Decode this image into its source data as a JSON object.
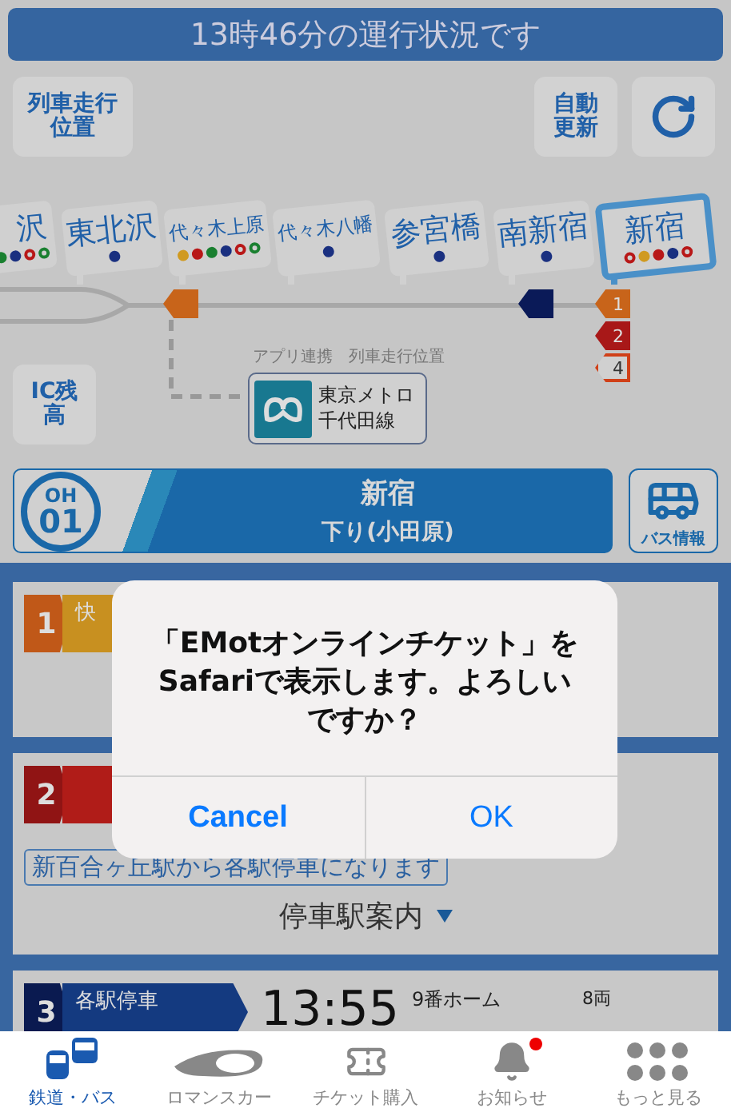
{
  "header": {
    "title": "13時46分の運行状況です"
  },
  "map": {
    "position_button": {
      "label": "列車走行位置"
    },
    "auto_update_button": {
      "label": "自動更新"
    },
    "ic_button": {
      "label": "IC残高"
    },
    "stations": [
      {
        "name": "沢",
        "selected": false,
        "dots": [
          {
            "color": "#1a8030",
            "hollow": false
          },
          {
            "color": "#1a3080",
            "hollow": false
          },
          {
            "color": "#b81818",
            "hollow": true
          },
          {
            "color": "#1a8030",
            "hollow": true
          }
        ]
      },
      {
        "name": "東北沢",
        "selected": false,
        "dots": [
          {
            "color": "#1a3080",
            "hollow": false
          }
        ]
      },
      {
        "name": "代々木上原",
        "selected": false,
        "trains": [
          {
            "color": "#c8641a",
            "outlined": false
          }
        ],
        "dots": [
          {
            "color": "#d09a20",
            "hollow": false
          },
          {
            "color": "#b81818",
            "hollow": false
          },
          {
            "color": "#1a8030",
            "hollow": false
          },
          {
            "color": "#1a3080",
            "hollow": false
          },
          {
            "color": "#b81818",
            "hollow": true
          },
          {
            "color": "#1a8030",
            "hollow": true
          }
        ]
      },
      {
        "name": "代々木八幡",
        "selected": false,
        "dots": [
          {
            "color": "#1a3080",
            "hollow": false
          }
        ]
      },
      {
        "name": "参宮橋",
        "selected": false,
        "dots": [
          {
            "color": "#1a3080",
            "hollow": false
          }
        ]
      },
      {
        "name": "南新宿",
        "selected": false,
        "trains": [
          {
            "color": "#0a1a58",
            "outlined": false
          }
        ],
        "dots": [
          {
            "color": "#1a3080",
            "hollow": false
          }
        ]
      },
      {
        "name": "新宿",
        "selected": true,
        "trains": [
          {
            "color": "#c8641a",
            "label": "1",
            "outlined": false
          },
          {
            "color": "#a81818",
            "label": "2",
            "outlined": false
          },
          {
            "color": "#d04018",
            "label": "4",
            "outlined": true
          }
        ],
        "dots": [
          {
            "color": "#b81818",
            "hollow": true
          },
          {
            "color": "#d09a20",
            "hollow": false
          },
          {
            "color": "#b81818",
            "hollow": false
          },
          {
            "color": "#1a3080",
            "hollow": false
          },
          {
            "color": "#b81818",
            "hollow": true
          }
        ]
      }
    ],
    "metro_link": {
      "caption": "アプリ連携　列車走行位置",
      "lines": [
        "東京メトロ",
        "千代田線"
      ]
    }
  },
  "station_panel": {
    "code_prefix": "OH",
    "code_number": "01",
    "name": "新宿",
    "direction": "下り(小田原)",
    "bus_button": "バス情報"
  },
  "departures": [
    {
      "number": "1",
      "color": "#c05818",
      "type": {
        "label": "快",
        "color": "#c89020"
      }
    },
    {
      "number": "2",
      "color": "#901414",
      "type": {
        "color": "#b01c18"
      },
      "notice": "新百合ヶ丘駅から各駅停車になります",
      "stops_button": "停車駅案内"
    },
    {
      "number": "3",
      "color": "#0a1a50",
      "type": {
        "label": "各駅停車",
        "color": "#143a80"
      },
      "time": "13:55",
      "platform": "9番ホーム",
      "cars": "8両"
    }
  ],
  "dialog": {
    "message_lines": [
      "「EMotオンラインチケット」を",
      "Safariで表示します。よろしい",
      "ですか？"
    ],
    "buttons": [
      {
        "label": "Cancel",
        "kind": "cancel"
      },
      {
        "label": "OK",
        "kind": "default"
      }
    ]
  },
  "tabs": [
    {
      "label": "鉄道・バス",
      "kind": "train-bus",
      "selected": true,
      "badge": false
    },
    {
      "label": "ロマンスカー",
      "kind": "romancecar",
      "selected": false,
      "badge": false
    },
    {
      "label": "チケット購入",
      "kind": "ticket",
      "selected": false,
      "badge": false
    },
    {
      "label": "お知らせ",
      "kind": "bell",
      "selected": false,
      "badge": true
    },
    {
      "label": "もっと見る",
      "kind": "more",
      "selected": false,
      "badge": false
    }
  ]
}
